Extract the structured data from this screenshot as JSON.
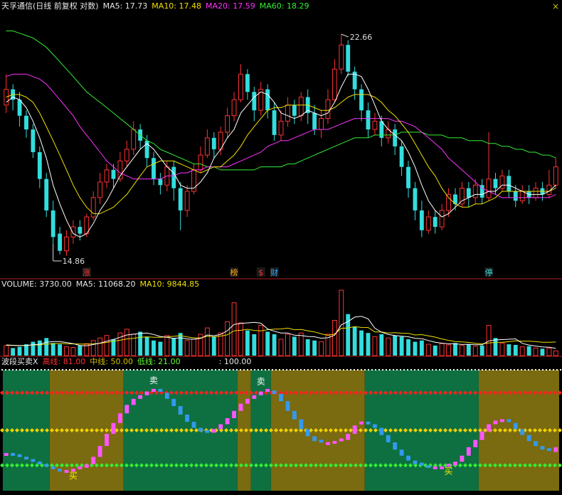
{
  "header": {
    "title": "天孚通信(日线 前复权 对数)",
    "ma5_label": "MA5: 17.73",
    "ma10_label": "MA10: 17.48",
    "ma20_label": "MA20: 17.59",
    "ma60_label": "MA60: 18.29",
    "close_glyph": "×"
  },
  "volume_header": {
    "label": "VOLUME: 3730.00",
    "ma5": "MA5: 11068.20",
    "ma10": "MA10: 9844.85"
  },
  "indicator_header": {
    "name": "波段买卖X",
    "high": "高线: 81.00",
    "mid": "中线: 50.00",
    "low": "低线: 21.00",
    "scale": ": 100.00"
  },
  "price_markers": {
    "high": "22.66",
    "low": "14.86"
  },
  "event_tags": [
    {
      "text": "涨",
      "idx": 12,
      "color": "#ff3030"
    },
    {
      "text": "榜",
      "idx": 34,
      "color": "#ffaa00"
    },
    {
      "text": "$",
      "idx": 38,
      "color": "#ff3030"
    },
    {
      "text": "财",
      "idx": 40,
      "color": "#33aaff"
    },
    {
      "text": "停",
      "idx": 72,
      "color": "#33dddd"
    }
  ],
  "signal_labels": [
    {
      "text": "卖",
      "idx": 22,
      "kind": "sell"
    },
    {
      "text": "卖",
      "idx": 38,
      "kind": "sell"
    },
    {
      "text": "买",
      "idx": 10,
      "kind": "buy"
    },
    {
      "text": "买",
      "idx": 66,
      "kind": "buy"
    }
  ],
  "colors": {
    "up": "#ff3333",
    "down": "#33dddd",
    "ma5": "#ffffff",
    "ma10": "#f0e000",
    "ma20": "#ff33ff",
    "ma60": "#33ee33",
    "high_line": "#ff2020",
    "mid_line": "#f0d000",
    "low_line": "#33ee33",
    "band_green": "#0e7040",
    "band_olive": "#7a6a10",
    "osc_up": "#ff55ff",
    "osc_down": "#3399ee"
  },
  "chart_data": {
    "type": "candlestick",
    "scale": "log",
    "price_ylim": [
      14.3,
      23.6
    ],
    "high_marker_idx": 50,
    "low_marker_idx": 7,
    "candles": [
      [
        19.8,
        20.4,
        21.0,
        19.5
      ],
      [
        20.4,
        20.0,
        20.6,
        19.6
      ],
      [
        20.0,
        19.4,
        20.3,
        19.0
      ],
      [
        19.4,
        18.9,
        19.6,
        18.6
      ],
      [
        18.9,
        18.1,
        19.1,
        17.9
      ],
      [
        18.1,
        17.2,
        18.3,
        16.9
      ],
      [
        17.2,
        16.2,
        17.4,
        16.0
      ],
      [
        16.2,
        15.4,
        16.5,
        15.2
      ],
      [
        15.5,
        15.0,
        15.7,
        14.9
      ],
      [
        15.0,
        15.4,
        15.6,
        14.86
      ],
      [
        15.4,
        15.7,
        15.9,
        15.2
      ],
      [
        15.7,
        15.5,
        15.9,
        15.3
      ],
      [
        15.5,
        16.0,
        16.1,
        15.4
      ],
      [
        16.0,
        16.6,
        16.8,
        15.9
      ],
      [
        16.6,
        17.1,
        17.4,
        16.4
      ],
      [
        17.1,
        17.5,
        17.7,
        16.9
      ],
      [
        17.5,
        17.2,
        17.7,
        16.9
      ],
      [
        17.2,
        17.8,
        18.1,
        17.1
      ],
      [
        17.8,
        18.2,
        18.5,
        17.6
      ],
      [
        18.2,
        18.9,
        19.2,
        18.0
      ],
      [
        18.9,
        18.5,
        19.1,
        18.2
      ],
      [
        18.5,
        17.9,
        18.7,
        17.6
      ],
      [
        17.9,
        17.2,
        18.1,
        17.0
      ],
      [
        17.2,
        17.0,
        17.4,
        16.7
      ],
      [
        17.0,
        17.6,
        17.8,
        16.8
      ],
      [
        17.6,
        16.9,
        17.8,
        16.5
      ],
      [
        16.9,
        16.2,
        17.1,
        15.6
      ],
      [
        16.2,
        16.8,
        17.0,
        16.0
      ],
      [
        16.8,
        17.5,
        17.7,
        16.7
      ],
      [
        17.5,
        18.0,
        18.3,
        17.4
      ],
      [
        18.0,
        18.6,
        18.9,
        17.9
      ],
      [
        18.6,
        18.2,
        18.8,
        17.9
      ],
      [
        18.2,
        18.8,
        19.0,
        18.0
      ],
      [
        18.8,
        19.4,
        19.7,
        18.6
      ],
      [
        19.4,
        20.0,
        20.3,
        19.2
      ],
      [
        20.0,
        21.0,
        21.4,
        19.9
      ],
      [
        21.0,
        20.3,
        21.2,
        20.0
      ],
      [
        20.3,
        19.6,
        20.5,
        19.2
      ],
      [
        19.6,
        20.4,
        20.7,
        19.4
      ],
      [
        20.4,
        19.6,
        20.6,
        19.3
      ],
      [
        19.6,
        18.7,
        19.9,
        18.5
      ],
      [
        18.7,
        19.2,
        19.6,
        18.5
      ],
      [
        19.2,
        19.8,
        20.1,
        19.0
      ],
      [
        19.8,
        19.4,
        20.0,
        19.1
      ],
      [
        19.4,
        20.1,
        20.3,
        19.2
      ],
      [
        20.1,
        19.5,
        20.4,
        19.1
      ],
      [
        19.5,
        18.9,
        19.8,
        18.7
      ],
      [
        18.9,
        19.3,
        19.6,
        18.6
      ],
      [
        19.3,
        20.0,
        20.4,
        19.1
      ],
      [
        20.0,
        21.2,
        21.6,
        19.9
      ],
      [
        21.2,
        22.2,
        22.66,
        21.0
      ],
      [
        22.2,
        21.1,
        22.4,
        20.9
      ],
      [
        21.1,
        20.4,
        21.3,
        20.0
      ],
      [
        20.4,
        19.6,
        20.6,
        19.2
      ],
      [
        19.6,
        18.9,
        19.9,
        18.6
      ],
      [
        18.9,
        19.2,
        19.5,
        18.7
      ],
      [
        19.2,
        18.6,
        19.4,
        18.3
      ],
      [
        18.6,
        18.9,
        19.2,
        18.4
      ],
      [
        18.9,
        18.3,
        19.1,
        18.0
      ],
      [
        18.3,
        17.6,
        18.5,
        17.3
      ],
      [
        17.6,
        16.9,
        17.8,
        16.6
      ],
      [
        16.9,
        16.2,
        17.1,
        15.9
      ],
      [
        16.2,
        15.6,
        16.5,
        15.4
      ],
      [
        15.6,
        16.0,
        16.2,
        15.5
      ],
      [
        16.0,
        15.7,
        16.2,
        15.5
      ],
      [
        15.7,
        16.2,
        16.4,
        15.6
      ],
      [
        16.2,
        16.7,
        16.9,
        16.0
      ],
      [
        16.7,
        16.4,
        16.9,
        16.2
      ],
      [
        16.4,
        16.9,
        17.1,
        16.3
      ],
      [
        16.9,
        16.6,
        17.1,
        16.3
      ],
      [
        16.6,
        17.0,
        17.2,
        16.4
      ],
      [
        17.0,
        16.6,
        17.2,
        16.4
      ],
      [
        16.6,
        17.2,
        18.8,
        16.5
      ],
      [
        17.2,
        16.9,
        17.4,
        16.7
      ],
      [
        16.9,
        17.3,
        17.5,
        16.8
      ],
      [
        17.3,
        16.8,
        17.5,
        16.6
      ],
      [
        16.8,
        16.5,
        17.0,
        16.3
      ],
      [
        16.5,
        16.8,
        17.0,
        16.4
      ],
      [
        16.8,
        16.6,
        17.0,
        16.4
      ],
      [
        16.6,
        16.9,
        17.1,
        16.5
      ],
      [
        16.9,
        16.7,
        17.1,
        16.5
      ],
      [
        16.7,
        17.0,
        17.5,
        16.6
      ],
      [
        17.0,
        17.6,
        17.9,
        16.9
      ]
    ],
    "ma5": [
      19.9,
      20.1,
      20.0,
      19.7,
      19.2,
      18.6,
      17.9,
      17.0,
      16.4,
      15.9,
      15.5,
      15.4,
      15.5,
      15.8,
      16.2,
      16.5,
      16.9,
      17.3,
      17.6,
      17.9,
      18.2,
      18.4,
      18.2,
      17.9,
      17.6,
      17.4,
      17.0,
      16.9,
      16.9,
      17.1,
      17.4,
      17.9,
      18.2,
      18.6,
      18.9,
      19.5,
      19.8,
      20.1,
      20.3,
      20.2,
      19.9,
      19.5,
      19.4,
      19.3,
      19.4,
      19.6,
      19.5,
      19.4,
      19.5,
      19.9,
      20.5,
      21.0,
      21.0,
      20.9,
      20.4,
      19.8,
      19.2,
      18.9,
      18.7,
      18.5,
      18.1,
      17.6,
      17.0,
      16.5,
      16.2,
      16.0,
      16.1,
      16.3,
      16.5,
      16.6,
      16.7,
      16.7,
      16.8,
      16.8,
      17.0,
      17.0,
      16.9,
      16.8,
      16.7,
      16.7,
      16.7,
      16.8,
      17.0
    ],
    "ma10": [
      20.1,
      20.2,
      20.2,
      20.1,
      19.9,
      19.5,
      19.0,
      18.5,
      18.0,
      17.5,
      17.0,
      16.6,
      16.3,
      16.1,
      16.1,
      16.2,
      16.3,
      16.5,
      16.7,
      17.0,
      17.3,
      17.6,
      17.7,
      17.8,
      17.8,
      17.8,
      17.7,
      17.6,
      17.5,
      17.4,
      17.5,
      17.6,
      17.6,
      17.8,
      18.0,
      18.3,
      18.7,
      19.0,
      19.3,
      19.6,
      19.7,
      19.7,
      19.8,
      19.8,
      19.8,
      19.8,
      19.7,
      19.6,
      19.6,
      19.7,
      19.9,
      20.1,
      20.2,
      20.2,
      20.2,
      20.1,
      19.9,
      19.6,
      19.4,
      19.1,
      18.8,
      18.4,
      18.0,
      17.6,
      17.3,
      16.9,
      16.6,
      16.4,
      16.3,
      16.3,
      16.4,
      16.4,
      16.5,
      16.6,
      16.8,
      16.8,
      16.8,
      16.8,
      16.8,
      16.8,
      16.8,
      16.8,
      16.9
    ],
    "ma20": [
      20.9,
      21.0,
      21.0,
      21.0,
      20.9,
      20.8,
      20.6,
      20.3,
      20.0,
      19.7,
      19.4,
      19.0,
      18.7,
      18.4,
      18.1,
      17.8,
      17.6,
      17.4,
      17.3,
      17.2,
      17.2,
      17.2,
      17.2,
      17.2,
      17.3,
      17.3,
      17.4,
      17.4,
      17.5,
      17.5,
      17.6,
      17.6,
      17.6,
      17.6,
      17.7,
      17.8,
      17.9,
      18.0,
      18.1,
      18.3,
      18.4,
      18.5,
      18.5,
      18.6,
      18.7,
      18.8,
      18.9,
      18.9,
      18.9,
      19.0,
      19.1,
      19.2,
      19.3,
      19.3,
      19.3,
      19.3,
      19.3,
      19.3,
      19.2,
      19.2,
      19.1,
      19.0,
      18.8,
      18.6,
      18.4,
      18.2,
      17.9,
      17.7,
      17.5,
      17.3,
      17.1,
      16.9,
      16.8,
      16.7,
      16.6,
      16.6,
      16.6,
      16.6,
      16.6,
      16.6,
      16.6,
      16.6,
      16.7
    ],
    "ma60": [
      22.8,
      22.8,
      22.7,
      22.6,
      22.5,
      22.3,
      22.1,
      21.8,
      21.5,
      21.2,
      20.9,
      20.6,
      20.3,
      20.1,
      19.9,
      19.7,
      19.5,
      19.3,
      19.1,
      18.9,
      18.7,
      18.5,
      18.4,
      18.2,
      18.1,
      18.0,
      17.9,
      17.8,
      17.7,
      17.7,
      17.6,
      17.6,
      17.5,
      17.5,
      17.5,
      17.5,
      17.5,
      17.5,
      17.6,
      17.6,
      17.6,
      17.6,
      17.7,
      17.7,
      17.8,
      17.9,
      18.0,
      18.1,
      18.2,
      18.3,
      18.4,
      18.5,
      18.6,
      18.6,
      18.6,
      18.7,
      18.7,
      18.7,
      18.7,
      18.8,
      18.8,
      18.8,
      18.8,
      18.7,
      18.7,
      18.7,
      18.6,
      18.6,
      18.6,
      18.5,
      18.5,
      18.5,
      18.4,
      18.4,
      18.3,
      18.3,
      18.2,
      18.2,
      18.1,
      18.1,
      18.0,
      18.0,
      17.9
    ],
    "volume_ylim": [
      0,
      52000
    ],
    "volume": [
      8000,
      6000,
      7000,
      9000,
      11000,
      12000,
      14000,
      10000,
      9000,
      7000,
      6500,
      8000,
      9500,
      12000,
      14000,
      16000,
      13000,
      18000,
      21000,
      17000,
      19000,
      15000,
      12000,
      11000,
      16000,
      14000,
      18000,
      12000,
      13000,
      17000,
      22000,
      15000,
      18000,
      27000,
      42000,
      26000,
      20000,
      17000,
      24000,
      19000,
      17000,
      13000,
      17000,
      15000,
      18000,
      13000,
      12000,
      11000,
      17000,
      28000,
      52000,
      33000,
      23000,
      20000,
      18000,
      15000,
      17000,
      14000,
      16000,
      15000,
      13000,
      11000,
      12000,
      9000,
      8000,
      9500,
      8500,
      10000,
      8000,
      9000,
      7500,
      8000,
      24000,
      14000,
      10000,
      9000,
      8500,
      7000,
      7500,
      6000,
      5500,
      6000,
      3730
    ],
    "volume_ma5": [
      8500,
      8200,
      7900,
      8000,
      8600,
      9000,
      10600,
      11200,
      11200,
      10400,
      9500,
      8100,
      7800,
      8800,
      9900,
      11500,
      12900,
      14600,
      16400,
      17000,
      17600,
      18000,
      16800,
      15200,
      14600,
      13600,
      14200,
      13200,
      13000,
      13600,
      16400,
      15800,
      16800,
      19800,
      24800,
      25600,
      26000,
      26400,
      25800,
      21200,
      19400,
      18000,
      18000,
      16200,
      16000,
      15200,
      15000,
      13800,
      14200,
      16200,
      24400,
      27000,
      30600,
      31200,
      29200,
      21800,
      18600,
      16800,
      16000,
      15400,
      15000,
      13800,
      13400,
      12000,
      10600,
      9900,
      9400,
      9400,
      8800,
      9000,
      8600,
      8600,
      11700,
      12500,
      12700,
      13000,
      13300,
      9700,
      8400,
      7600,
      6900,
      6600,
      5800
    ],
    "volume_ma10": [
      8200,
      8100,
      8000,
      8100,
      8400,
      8600,
      9100,
      9400,
      9700,
      9400,
      9300,
      9200,
      9100,
      9300,
      9800,
      10500,
      11400,
      12200,
      13300,
      13700,
      14600,
      14900,
      14600,
      14500,
      14900,
      15300,
      15900,
      14800,
      14100,
      14100,
      15400,
      15000,
      15500,
      16500,
      19700,
      20100,
      20900,
      20000,
      19600,
      20600,
      21000,
      21200,
      21800,
      20600,
      20800,
      19700,
      18800,
      17300,
      16100,
      17200,
      21700,
      22000,
      23000,
      22400,
      22300,
      18800,
      18800,
      18000,
      18200,
      17800,
      17700,
      16400,
      16700,
      15700,
      14700,
      13200,
      12100,
      11200,
      10900,
      10500,
      9800,
      9300,
      10000,
      10500,
      10600,
      11000,
      11700,
      11500,
      11500,
      11200,
      10600,
      10600,
      10800
    ],
    "osc_ylim": [
      0,
      100
    ],
    "osc_high": 81,
    "osc_mid": 50,
    "osc_low": 21,
    "osc": [
      30,
      29,
      27,
      25,
      23,
      21,
      19,
      17,
      16,
      16,
      17,
      19,
      22,
      28,
      37,
      47,
      56,
      64,
      71,
      76,
      79,
      82,
      83,
      81,
      76,
      70,
      63,
      57,
      52,
      49,
      48,
      51,
      55,
      60,
      66,
      72,
      76,
      79,
      82,
      83,
      80,
      74,
      66,
      59,
      51,
      45,
      41,
      39,
      39,
      40,
      42,
      47,
      54,
      56,
      55,
      52,
      46,
      40,
      34,
      29,
      25,
      22,
      20,
      19,
      19,
      19,
      21,
      24,
      29,
      36,
      42,
      49,
      55,
      58,
      58,
      56,
      51,
      46,
      41,
      37,
      34,
      32,
      36
    ],
    "band_boundaries": [
      7,
      18,
      35,
      37,
      40,
      54,
      71,
      86
    ],
    "band_colors": [
      "green",
      "olive",
      "green",
      "olive",
      "green",
      "olive",
      "green",
      "olive",
      "green"
    ]
  }
}
